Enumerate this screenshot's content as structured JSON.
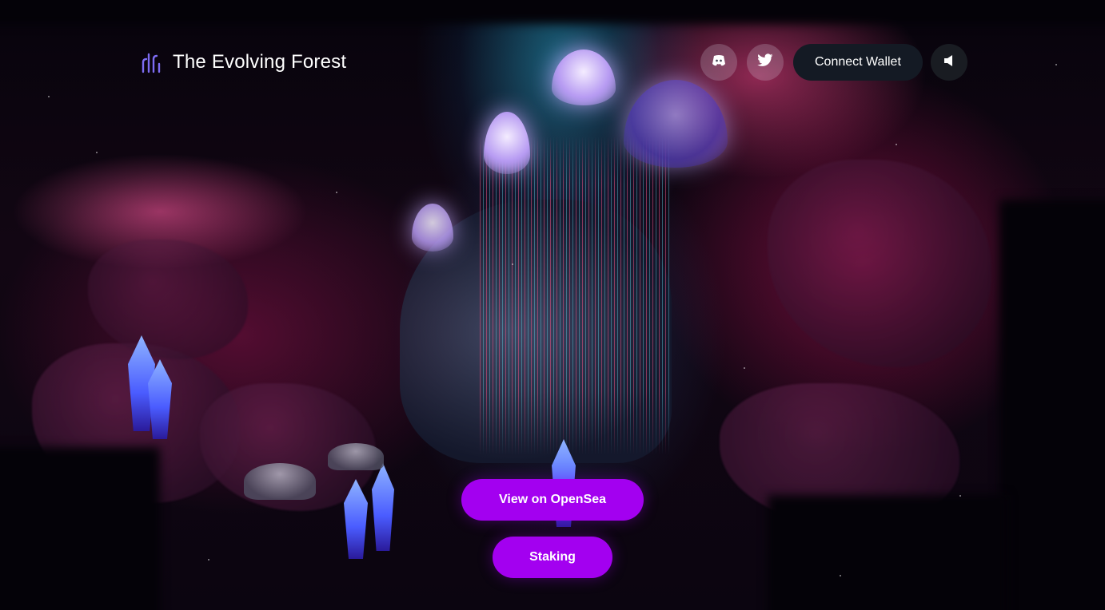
{
  "header": {
    "logo_icon": "tendril-logo-icon",
    "title": "The Evolving Forest",
    "social": [
      {
        "name": "discord",
        "icon": "discord-icon"
      },
      {
        "name": "twitter",
        "icon": "twitter-icon"
      }
    ],
    "connect_wallet_label": "Connect Wallet",
    "sound_icon": "speaker-icon"
  },
  "hero": {
    "background": "glowing-cave-forest-scene",
    "buttons": {
      "opensea_label": "View on OpenSea",
      "staking_label": "Staking"
    }
  },
  "colors": {
    "accent_purple": "#a300f0",
    "logo_purple": "#7d6cf2",
    "wallet_button_bg": "#141a24"
  }
}
